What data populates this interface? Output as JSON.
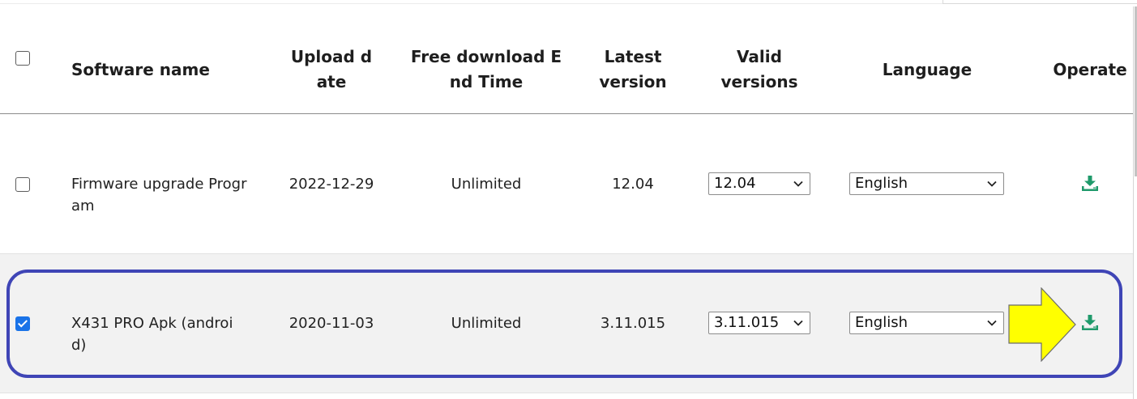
{
  "table": {
    "headers": {
      "software_name": [
        "Software name"
      ],
      "upload_date": [
        "Upload d",
        "ate"
      ],
      "free_download_end_time": [
        "Free download E",
        "nd Time"
      ],
      "latest_version": [
        "Latest",
        "version"
      ],
      "valid_versions": [
        "Valid",
        "versions"
      ],
      "language": [
        "Language"
      ],
      "operate": [
        "Operate"
      ]
    },
    "rows": [
      {
        "checked": false,
        "name_lines": [
          "Firmware upgrade Progr",
          "am"
        ],
        "upload_date": "2022-12-29",
        "free_download_end_time": "Unlimited",
        "latest_version": "12.04",
        "valid_version_selected": "12.04",
        "language_selected": "English",
        "operate_icon": "download-icon"
      },
      {
        "checked": true,
        "name_lines": [
          "X431 PRO Apk (androi",
          "d)"
        ],
        "upload_date": "2020-11-03",
        "free_download_end_time": "Unlimited",
        "latest_version": "3.11.015",
        "valid_version_selected": "3.11.015",
        "language_selected": "English",
        "operate_icon": "download-icon"
      }
    ]
  },
  "annotations": {
    "highlight_color": "#3f45b6",
    "arrow_color": "#ffff00"
  },
  "colors": {
    "checkbox_checked": "#1a73e8",
    "download_icon": "#1f9a6b"
  }
}
